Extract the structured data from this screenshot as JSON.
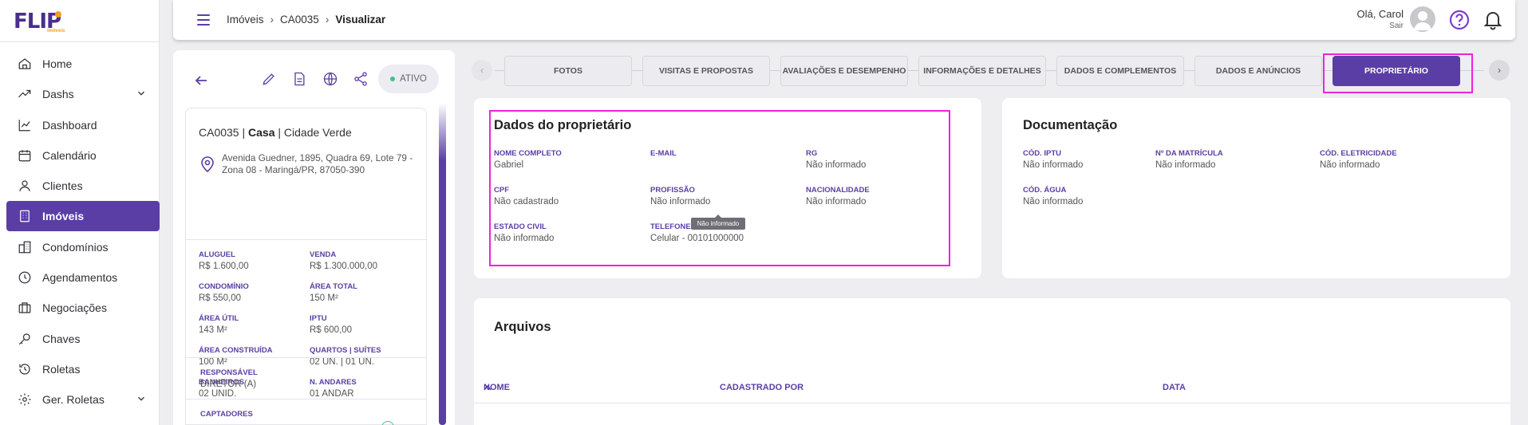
{
  "logo": {
    "text": "FLIP",
    "sub": "imóveis"
  },
  "sidebar": {
    "items": [
      {
        "label": "Home",
        "icon": "home-icon"
      },
      {
        "label": "Dashs",
        "icon": "trending-icon",
        "expandable": true
      },
      {
        "label": "Dashboard",
        "icon": "chart-icon"
      },
      {
        "label": "Calendário",
        "icon": "calendar-icon"
      },
      {
        "label": "Clientes",
        "icon": "user-icon"
      },
      {
        "label": "Imóveis",
        "icon": "building-icon",
        "active": true
      },
      {
        "label": "Condomínios",
        "icon": "buildings-icon"
      },
      {
        "label": "Agendamentos",
        "icon": "clock-icon"
      },
      {
        "label": "Negociações",
        "icon": "briefcase-icon"
      },
      {
        "label": "Chaves",
        "icon": "key-icon"
      },
      {
        "label": "Roletas",
        "icon": "rotate-icon"
      },
      {
        "label": "Ger. Roletas",
        "icon": "gear-icon",
        "expandable": true
      }
    ]
  },
  "header": {
    "breadcrumbs": [
      "Imóveis",
      "CA0035",
      "Visualizar"
    ],
    "greeting": "Olá, Carol",
    "logout": "Sair"
  },
  "property": {
    "status": "ATIVO",
    "code": "CA0035",
    "type": "Casa",
    "condo": "Cidade Verde",
    "address": "Avenida Guedner, 1895, Quadra 69, Lote 79 - Zona 08 - Maringá/PR, 87050-390",
    "fields": [
      {
        "k": "ALUGUEL",
        "v": "R$ 1.600,00"
      },
      {
        "k": "VENDA",
        "v": "R$ 1.300.000,00"
      },
      {
        "k": "CONDOMÍNIO",
        "v": "R$ 550,00"
      },
      {
        "k": "ÁREA TOTAL",
        "v": "150 M²"
      },
      {
        "k": "ÁREA ÚTIL",
        "v": "143 M²"
      },
      {
        "k": "IPTU",
        "v": "R$ 600,00"
      },
      {
        "k": "ÁREA CONSTRUÍDA",
        "v": "100 M²"
      },
      {
        "k": "QUARTOS | SUÍTES",
        "v": "02 UN. | 01 UN."
      },
      {
        "k": "BANHEIROS",
        "v": "02 UNID."
      },
      {
        "k": "N. ANDARES",
        "v": "01 ANDAR"
      }
    ],
    "responsible_label": "RESPONSÁVEL",
    "responsible": "DIRETOR (A)",
    "captors_label": "CAPTADORES"
  },
  "tabs": [
    {
      "label": "FOTOS"
    },
    {
      "label": "VISITAS E PROPOSTAS"
    },
    {
      "label": "AVALIAÇÕES E DESEMPENHO"
    },
    {
      "label": "INFORMAÇÕES E DETALHES"
    },
    {
      "label": "DADOS E COMPLEMENTOS"
    },
    {
      "label": "DADOS E ANÚNCIOS"
    },
    {
      "label": "PROPRIETÁRIO",
      "active": true
    }
  ],
  "owner": {
    "title": "Dados do proprietário",
    "fields": [
      {
        "k": "NOME COMPLETO",
        "v": "Gabriel"
      },
      {
        "k": "E-MAIL",
        "v": ""
      },
      {
        "k": "RG",
        "v": "Não informado"
      },
      {
        "k": "CPF",
        "v": "Não cadastrado"
      },
      {
        "k": "PROFISSÃO",
        "v": "Não informado"
      },
      {
        "k": "NACIONALIDADE",
        "v": "Não informado"
      },
      {
        "k": "ESTADO CIVIL",
        "v": "Não informado"
      },
      {
        "k": "TELEFONE",
        "v": "Celular - 00101000000"
      }
    ],
    "tooltip": "Não informado"
  },
  "docs": {
    "title": "Documentação",
    "fields": [
      {
        "k": "CÓD. IPTU",
        "v": "Não informado"
      },
      {
        "k": "Nº DA MATRÍCULA",
        "v": "Não informado"
      },
      {
        "k": "CÓD. ELETRICIDADE",
        "v": "Não informado"
      },
      {
        "k": "CÓD. ÁGUA",
        "v": "Não informado"
      }
    ]
  },
  "files": {
    "title": "Arquivos",
    "columns": [
      "NOME",
      "CADASTRADO POR",
      "DATA"
    ]
  },
  "colors": {
    "primary": "#5a3ea6",
    "highlight": "#ee22dd",
    "status": "#3fc28b"
  }
}
